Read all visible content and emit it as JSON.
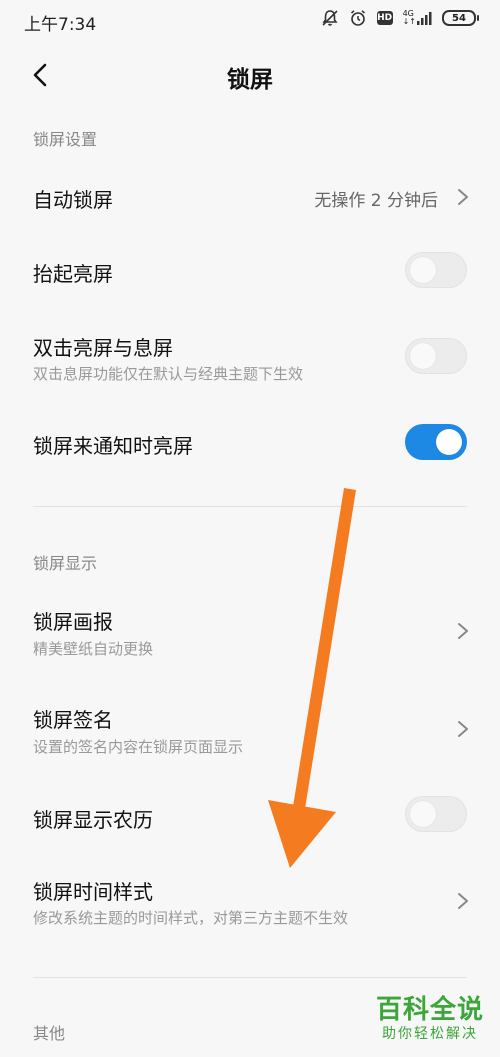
{
  "status_bar": {
    "time": "上午7:34",
    "hd_label": "HD",
    "network_label": "4G",
    "battery_level": "54"
  },
  "header": {
    "title": "锁屏"
  },
  "sections": {
    "lock_settings": {
      "title": "锁屏设置",
      "auto_lock": {
        "label": "自动锁屏",
        "value": "无操作 2 分钟后"
      },
      "raise_to_wake": {
        "label": "抬起亮屏",
        "enabled": false
      },
      "double_tap": {
        "label": "双击亮屏与息屏",
        "sub": "双击息屏功能仅在默认与经典主题下生效",
        "enabled": false
      },
      "wake_on_notification": {
        "label": "锁屏来通知时亮屏",
        "enabled": true
      }
    },
    "lock_display": {
      "title": "锁屏显示",
      "wallpaper_carousel": {
        "label": "锁屏画报",
        "sub": "精美壁纸自动更换"
      },
      "signature": {
        "label": "锁屏签名",
        "sub": "设置的签名内容在锁屏页面显示"
      },
      "lunar_calendar": {
        "label": "锁屏显示农历",
        "enabled": false
      },
      "clock_style": {
        "label": "锁屏时间样式",
        "sub": "修改系统主题的时间样式，对第三方主题不生效"
      }
    },
    "other": {
      "title": "其他"
    }
  },
  "watermark": {
    "main": "百科全说",
    "sub": "助你轻松解决"
  },
  "colors": {
    "accent_blue": "#1e88e5",
    "annotation_orange": "#f47b20",
    "watermark_green": "#3ca63a"
  }
}
